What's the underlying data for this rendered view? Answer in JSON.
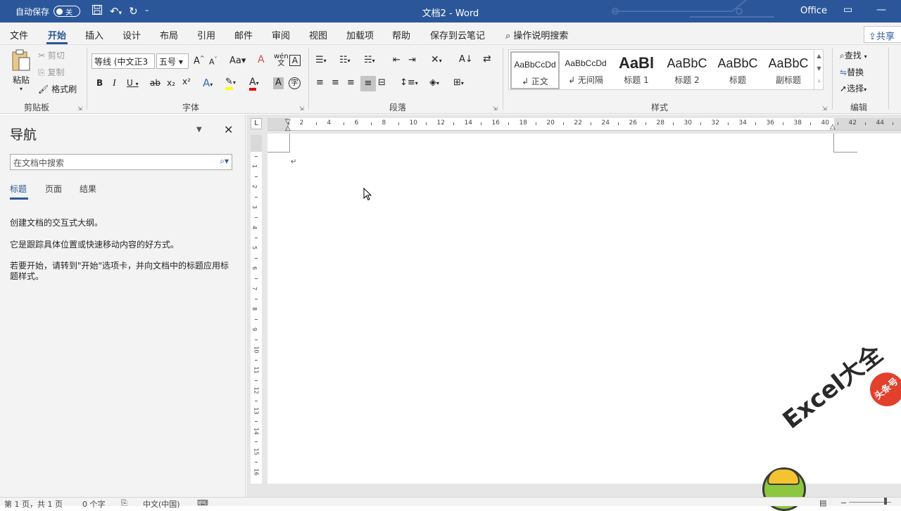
{
  "titlebar": {
    "autosave_label": "自动保存",
    "autosave_state": "关",
    "title": "文档2 - Word",
    "office_label": "Office",
    "customize_glyph": "⁼"
  },
  "menu": {
    "tabs": [
      "文件",
      "开始",
      "插入",
      "设计",
      "布局",
      "引用",
      "邮件",
      "审阅",
      "视图",
      "加载项",
      "帮助",
      "保存到云笔记"
    ],
    "active_tab": "开始",
    "tell_me": "操作说明搜索",
    "share": "共享"
  },
  "ribbon": {
    "clipboard": {
      "paste": "粘贴",
      "cut": "剪切",
      "copy": "复制",
      "format_painter": "格式刷",
      "group": "剪贴板"
    },
    "font": {
      "font_name": "等线 (中文正3",
      "font_size": "五号",
      "group": "字体",
      "phonetic": "wén",
      "bold": "B",
      "italic": "I",
      "underline": "U",
      "strike": "ab",
      "subscript": "x₂",
      "superscript": "x²",
      "case": "Aa",
      "char_border": "A",
      "grow": "A",
      "shrink": "A",
      "text_effect": "A",
      "font_color": "A",
      "shading": "A",
      "enclose": "字"
    },
    "paragraph": {
      "group": "段落"
    },
    "styles": {
      "group": "样式",
      "items": [
        {
          "preview": "AaBbCcDd",
          "name": "↲ 正文"
        },
        {
          "preview": "AaBbCcDd",
          "name": "↲ 无间隔"
        },
        {
          "preview": "AaBl",
          "name": "标题 1"
        },
        {
          "preview": "AaBbC",
          "name": "标题 2"
        },
        {
          "preview": "AaBbC",
          "name": "标题"
        },
        {
          "preview": "AaBbC",
          "name": "副标题"
        }
      ]
    },
    "editing": {
      "find": "查找",
      "replace": "替换",
      "select": "选择",
      "group": "编辑"
    }
  },
  "nav": {
    "title": "导航",
    "search_placeholder": "在文档中搜索",
    "tabs": [
      "标题",
      "页面",
      "结果"
    ],
    "active_tab": "标题",
    "text1": "创建文档的交互式大纲。",
    "text2": "它是跟踪具体位置或快速移动内容的好方式。",
    "text3": "若要开始，请转到\"开始\"选项卡，并向文档中的标题应用标题样式。"
  },
  "ruler": {
    "h_labels": [
      "2",
      "4",
      "6",
      "8",
      "10",
      "12",
      "14",
      "16",
      "18",
      "20",
      "22",
      "24",
      "26",
      "28",
      "30",
      "32",
      "34",
      "36",
      "38",
      "40",
      "42",
      "44"
    ],
    "v_labels": [
      "1",
      "2",
      "3",
      "4",
      "5",
      "6",
      "7",
      "8",
      "9",
      "10",
      "11",
      "12",
      "13",
      "14",
      "15",
      "16"
    ],
    "tab_selector": "L"
  },
  "document": {
    "paragraph_mark": "↵"
  },
  "status": {
    "page": "第 1 页，共 1 页",
    "words": "0 个字",
    "language": "中文(中国)"
  },
  "watermark": {
    "text": "Excel大全",
    "badge": "头条号"
  },
  "colors": {
    "brand": "#2b579a",
    "ribbon_bg": "#f3f3f3",
    "doc_bg": "#e6e6e6"
  }
}
